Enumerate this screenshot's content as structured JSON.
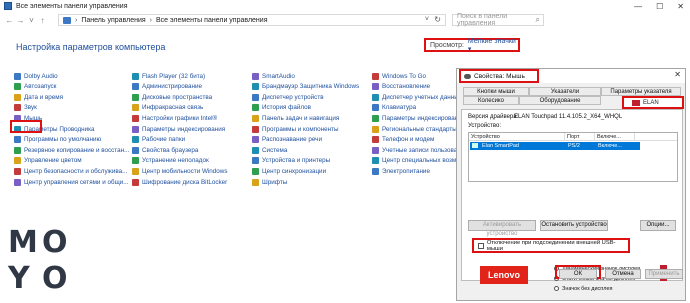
{
  "window": {
    "title": "Все элементы панели управления",
    "controls": [
      "—",
      "☐",
      "✕"
    ]
  },
  "address": {
    "crumb1": "Панель управления",
    "crumb2": "Все элементы панели управления",
    "search_placeholder": "Поиск в панели управления"
  },
  "heading": "Настройка параметров компьютера",
  "view_by": {
    "label": "Просмотр:",
    "value": "Мелкие значки ▾"
  },
  "items": {
    "col1": [
      "Dolby Audio",
      "Автозапуск",
      "Дата и время",
      "Звук",
      "Мышь",
      "Параметры Проводника",
      "Программы по умолчанию",
      "Резервное копирование и восстан...",
      "Управление цветом",
      "Центр безопасности и обслужива...",
      "Центр управления сетями и общи..."
    ],
    "col2": [
      "Flash Player (32 бита)",
      "Администрирование",
      "Дисковые пространства",
      "Инфракрасная связь",
      "Настройки графики Intel®",
      "Параметры индексирования",
      "Рабочие папки",
      "Свойства браузера",
      "Устранение неполадок",
      "Центр мобильности Windows",
      "Шифрование диска BitLocker"
    ],
    "col3": [
      "SmartAudio",
      "Брандмауэр Защитника Windows",
      "Диспетчер устройств",
      "История файлов",
      "Панель задач и навигация",
      "Программы и компоненты",
      "Распознавание речи",
      "Система",
      "Устройства и принтеры",
      "Центр синхронизации",
      "Шрифты"
    ],
    "col4": [
      "Windows To Go",
      "Восстановление",
      "Диспетчер учетных данных",
      "Клавиатура",
      "Параметры индексирования",
      "Региональные стандарты",
      "Телефон и модем",
      "Учетные записи пользователей",
      "Центр специальных возможностей",
      "Электропитание"
    ]
  },
  "dialog": {
    "title": "Свойства: Мышь",
    "tabs_row1": [
      "Кнопки мыши",
      "Указатели",
      "Параметры указателя"
    ],
    "tabs_row2": [
      "Колесико",
      "Оборудование"
    ],
    "elan_tab": "ELAN",
    "driver_label": "Версия драйвера:",
    "driver_value": "ELAN Touchpad 11.4.105.2_X64_WHQL",
    "device_label": "Устройство:",
    "table_head": [
      "Устройство",
      "Порт",
      "Включе..."
    ],
    "table_row": [
      "Elan SmartPad",
      "PS/2",
      "Включе..."
    ],
    "btn_activate": "Активировать устройство",
    "btn_stop": "Остановить устройство",
    "btn_options": "Опции...",
    "usb_text": "Отключение при подсоединении внешней USB-мыши",
    "lenovo": "Lenovo",
    "radio": [
      "Динамический значок дисплея",
      "Статический значок дисплея",
      "Значок без дисплея"
    ],
    "btn_ok": "ОК",
    "btn_cancel": "Отмена",
    "btn_apply": "Применить"
  },
  "logo": [
    "M",
    "O",
    "Y",
    "O"
  ],
  "colors": {
    "accent": "#1e4f9e",
    "highlight": "#dd1111",
    "lenovo": "#e2231a",
    "selected": "#0078d7"
  }
}
